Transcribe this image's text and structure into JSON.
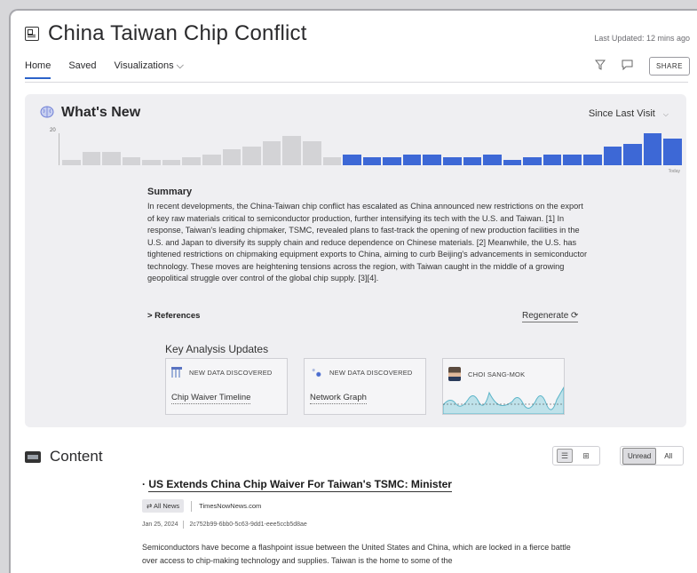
{
  "header": {
    "title": "China Taiwan Chip Conflict",
    "last_updated": "Last Updated: 12 mins ago",
    "tabs": [
      {
        "label": "Home",
        "active": true
      },
      {
        "label": "Saved",
        "active": false
      },
      {
        "label": "Visualizations ⌵",
        "active": false
      }
    ],
    "share_label": "SHARE",
    "icons": [
      "filter-icon",
      "comment-icon"
    ]
  },
  "whats_new": {
    "title": "What's New",
    "since_label": "Since Last Visit",
    "chart": {
      "y_tick": "20",
      "today_label": "Today",
      "colors": {
        "past": "#d3d3d6",
        "new": "#3d68d6"
      },
      "values": [
        2,
        5,
        5,
        3,
        2,
        2,
        3,
        4,
        6,
        7,
        9,
        11,
        9,
        3,
        4,
        3,
        3,
        4,
        4,
        3,
        3,
        4,
        2,
        3,
        4,
        4,
        4,
        7,
        8,
        12,
        10
      ],
      "new_from_index": 14
    }
  },
  "summary": {
    "heading": "Summary",
    "text": "In recent developments, the China-Taiwan chip conflict has escalated as China announced new restrictions on the export of key raw materials critical to semiconductor production, further intensifying its tech with the U.S. and Taiwan. [1] In response, Taiwan's leading chipmaker, TSMC, revealed plans to fast-track the opening of new production facilities in the U.S. and Japan to diversify its supply chain and reduce dependence on Chinese materials. [2] Meanwhile, the U.S. has tightened restrictions on chipmaking equipment exports to China, aiming to curb Beijing's advancements in semiconductor technology. These moves are heightening tensions across the region, with Taiwan caught in the middle of a growing geopolitical struggle over control of the global chip supply. [3][4].",
    "references_label": "> References",
    "regenerate_label": "Regenerate"
  },
  "key_analysis": {
    "title": "Key Analysis Updates",
    "cards": [
      {
        "badge": "NEW DATA DISCOVERED",
        "link": "Chip Waiver Timeline"
      },
      {
        "badge": "NEW DATA DISCOVERED",
        "link": "Network Graph"
      },
      {
        "badge": "CHOI SANG-MOK",
        "link": ""
      }
    ]
  },
  "content": {
    "title": "Content",
    "read_toggle": {
      "unread": "Unread",
      "all": "All"
    },
    "article": {
      "bullet": "·",
      "title": "US Extends China Chip Waiver For Taiwan's TSMC: Minister",
      "badge": "All News",
      "source": "TimesNowNews.com",
      "date": "Jan 25, 2024",
      "id": "2c752b99-6bb0-5c63-9dd1-eee5ccb5d8ae",
      "body": "Semiconductors have become a flashpoint issue between the United States and China, which are locked in a fierce battle over access to chip-making technology and supplies. Taiwan is the home to some of the"
    }
  }
}
